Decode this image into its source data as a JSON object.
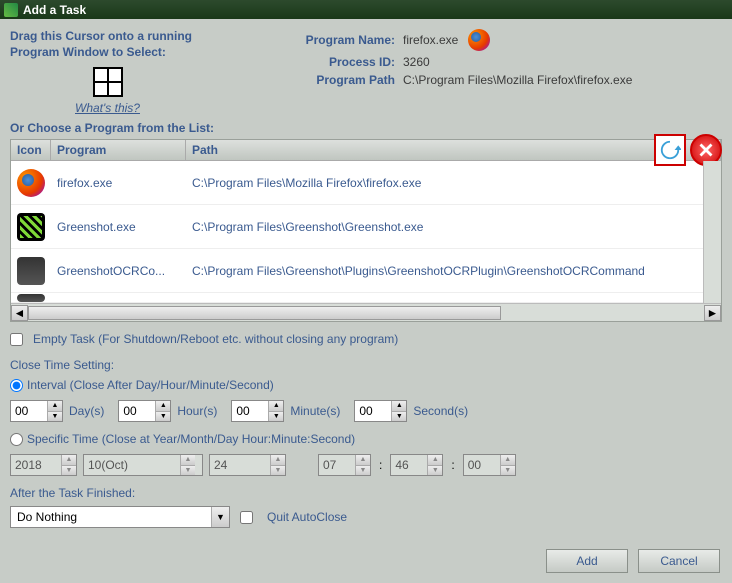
{
  "window": {
    "title": "Add a Task"
  },
  "cursor": {
    "label_line1": "Drag this Cursor onto a running",
    "label_line2": "Program Window to Select:",
    "whats_this": "What's this?"
  },
  "info": {
    "program_name_label": "Program Name:",
    "program_name": "firefox.exe",
    "process_id_label": "Process ID:",
    "process_id": "3260",
    "program_path_label": "Program Path",
    "program_path": "C:\\Program Files\\Mozilla Firefox\\firefox.exe"
  },
  "choose_label": "Or Choose a Program from the List:",
  "columns": {
    "icon": "Icon",
    "program": "Program",
    "path": "Path"
  },
  "programs": [
    {
      "name": "firefox.exe",
      "path": "C:\\Program Files\\Mozilla Firefox\\firefox.exe",
      "icon": "firefox"
    },
    {
      "name": "Greenshot.exe",
      "path": "C:\\Program Files\\Greenshot\\Greenshot.exe",
      "icon": "greenshot"
    },
    {
      "name": "GreenshotOCRCo...",
      "path": "C:\\Program Files\\Greenshot\\Plugins\\GreenshotOCRPlugin\\GreenshotOCRCommand",
      "icon": "ocr"
    }
  ],
  "empty_task_label": "Empty Task (For Shutdown/Reboot etc. without closing any program)",
  "close_time_label": "Close Time Setting:",
  "interval": {
    "label": "Interval (Close After Day/Hour/Minute/Second)",
    "day": "00",
    "day_lbl": "Day(s)",
    "hour": "00",
    "hour_lbl": "Hour(s)",
    "minute": "00",
    "minute_lbl": "Minute(s)",
    "second": "00",
    "second_lbl": "Second(s)"
  },
  "specific": {
    "label": "Specific Time (Close at Year/Month/Day Hour:Minute:Second)",
    "year": "2018",
    "month": "10(Oct)",
    "day": "24",
    "hour": "07",
    "minute": "46",
    "second": "00"
  },
  "after_label": "After the Task Finished:",
  "after_action": "Do Nothing",
  "quit_label": "Quit AutoClose",
  "buttons": {
    "add": "Add",
    "cancel": "Cancel"
  }
}
